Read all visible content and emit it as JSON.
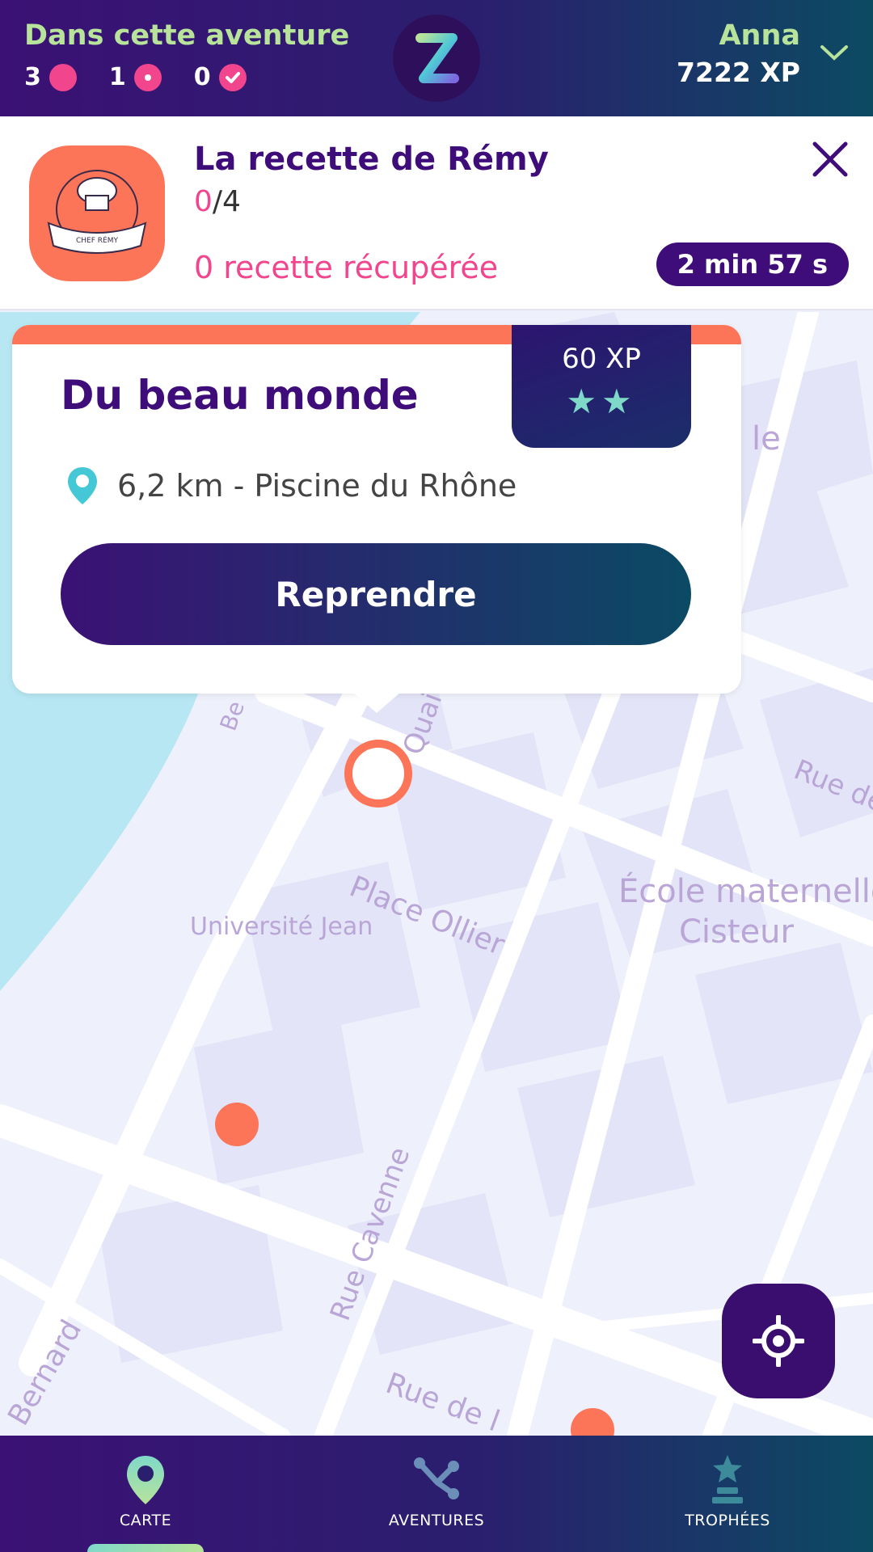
{
  "header": {
    "adventure_title": "Dans cette aventure",
    "counts": [
      {
        "value": "3",
        "icon": "pink-dot-icon"
      },
      {
        "value": "1",
        "icon": "pink-ring-dot-icon"
      },
      {
        "value": "0",
        "icon": "pink-check-icon"
      }
    ],
    "logo": "z-logo-icon",
    "user_name": "Anna",
    "user_xp": "7222 XP"
  },
  "adventure": {
    "title": "La recette de Rémy",
    "progress_done": "0",
    "progress_total": "/4",
    "status": "0 recette récupérée",
    "timer": "2 min 57 s",
    "avatar_icon": "chef-remy-badge-icon"
  },
  "card": {
    "title": "Du beau monde",
    "xp": "60 XP",
    "stars": "★★",
    "star_count": 2,
    "location": "6,2 km - Piscine du Rhône",
    "button": "Reprendre"
  },
  "map": {
    "labels": [
      "Place Ollier",
      "Rue Cavenne",
      "École maternelle",
      "Cisteur",
      "Quai C",
      "Rue de",
      "Rue de l",
      "Bernard",
      "Université Jean",
      "le",
      "Be"
    ]
  },
  "nav": {
    "items": [
      {
        "label": "CARTE",
        "icon": "map-pin-icon",
        "active": true
      },
      {
        "label": "AVENTURES",
        "icon": "share-nodes-icon",
        "active": false
      },
      {
        "label": "TROPHÉES",
        "icon": "trophy-star-icon",
        "active": false
      }
    ]
  },
  "colors": {
    "primary": "#3f0d7a",
    "accent_pink": "#f1458e",
    "accent_orange": "#fc7558",
    "accent_green": "#b7e39a",
    "accent_teal": "#7fd9c9"
  }
}
